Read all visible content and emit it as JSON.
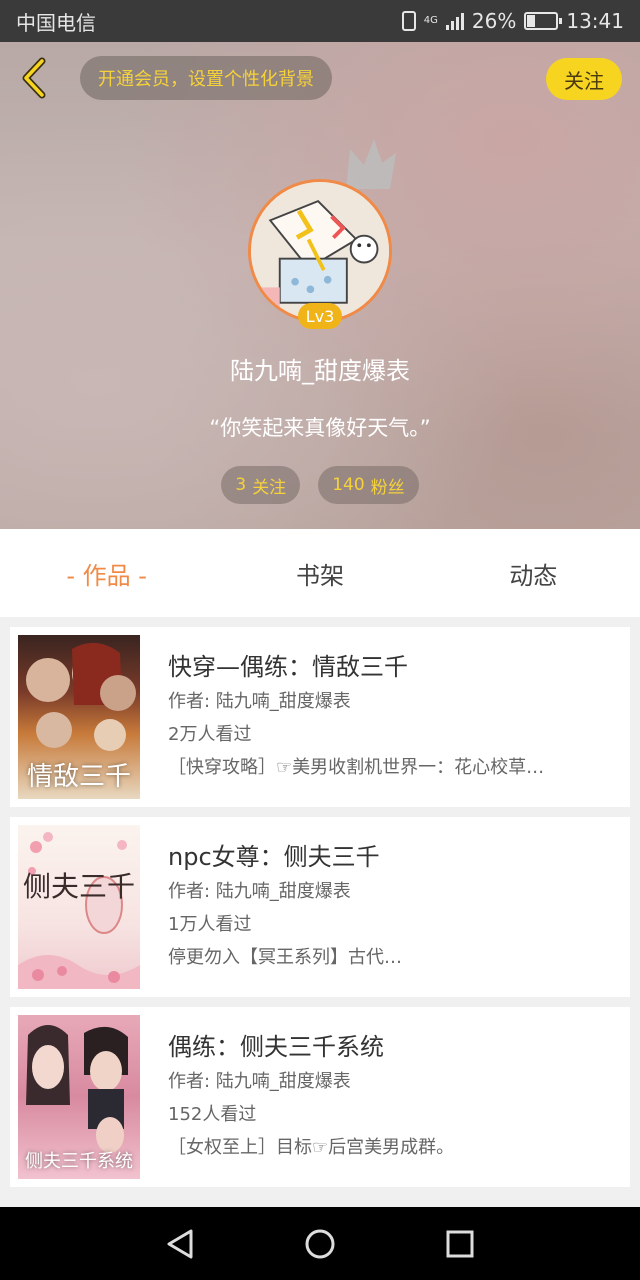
{
  "status_bar": {
    "carrier": "中国电信",
    "network": "4G",
    "battery": "26%",
    "battery_level": 0.26,
    "time": "13:41"
  },
  "header": {
    "vip_text": "开通会员，设置个性化背景",
    "follow_label": "关注",
    "level": "Lv3",
    "username": "陆九喃_甜度爆表",
    "motto": "“你笑起来真像好天气。”",
    "stats": [
      {
        "count": "3",
        "label": "关注"
      },
      {
        "count": "140",
        "label": "粉丝"
      }
    ]
  },
  "tabs": [
    {
      "label": "- 作品 -",
      "active": true
    },
    {
      "label": "书架",
      "active": false
    },
    {
      "label": "动态",
      "active": false
    }
  ],
  "books": [
    {
      "title": "快穿—偶练：情敌三千",
      "author": "作者: 陆九喃_甜度爆表",
      "views": "2万人看过",
      "desc": "［快穿攻略］☞美男收割机世界一：花心校草…",
      "cover_text": "情敌三千"
    },
    {
      "title": "npc女尊：侧夫三千",
      "author": "作者: 陆九喃_甜度爆表",
      "views": "1万人看过",
      "desc": "停更勿入【冥王系列】古代…",
      "cover_text": "侧夫三千"
    },
    {
      "title": "偶练：侧夫三千系统",
      "author": "作者: 陆九喃_甜度爆表",
      "views": "152人看过",
      "desc": "［女权至上］目标☞后宫美男成群。",
      "cover_text": "侧夫三千系统"
    }
  ],
  "colors": {
    "accent": "#f08a46",
    "follow_yellow": "#f7d420",
    "stat_text": "#f6d23a"
  }
}
